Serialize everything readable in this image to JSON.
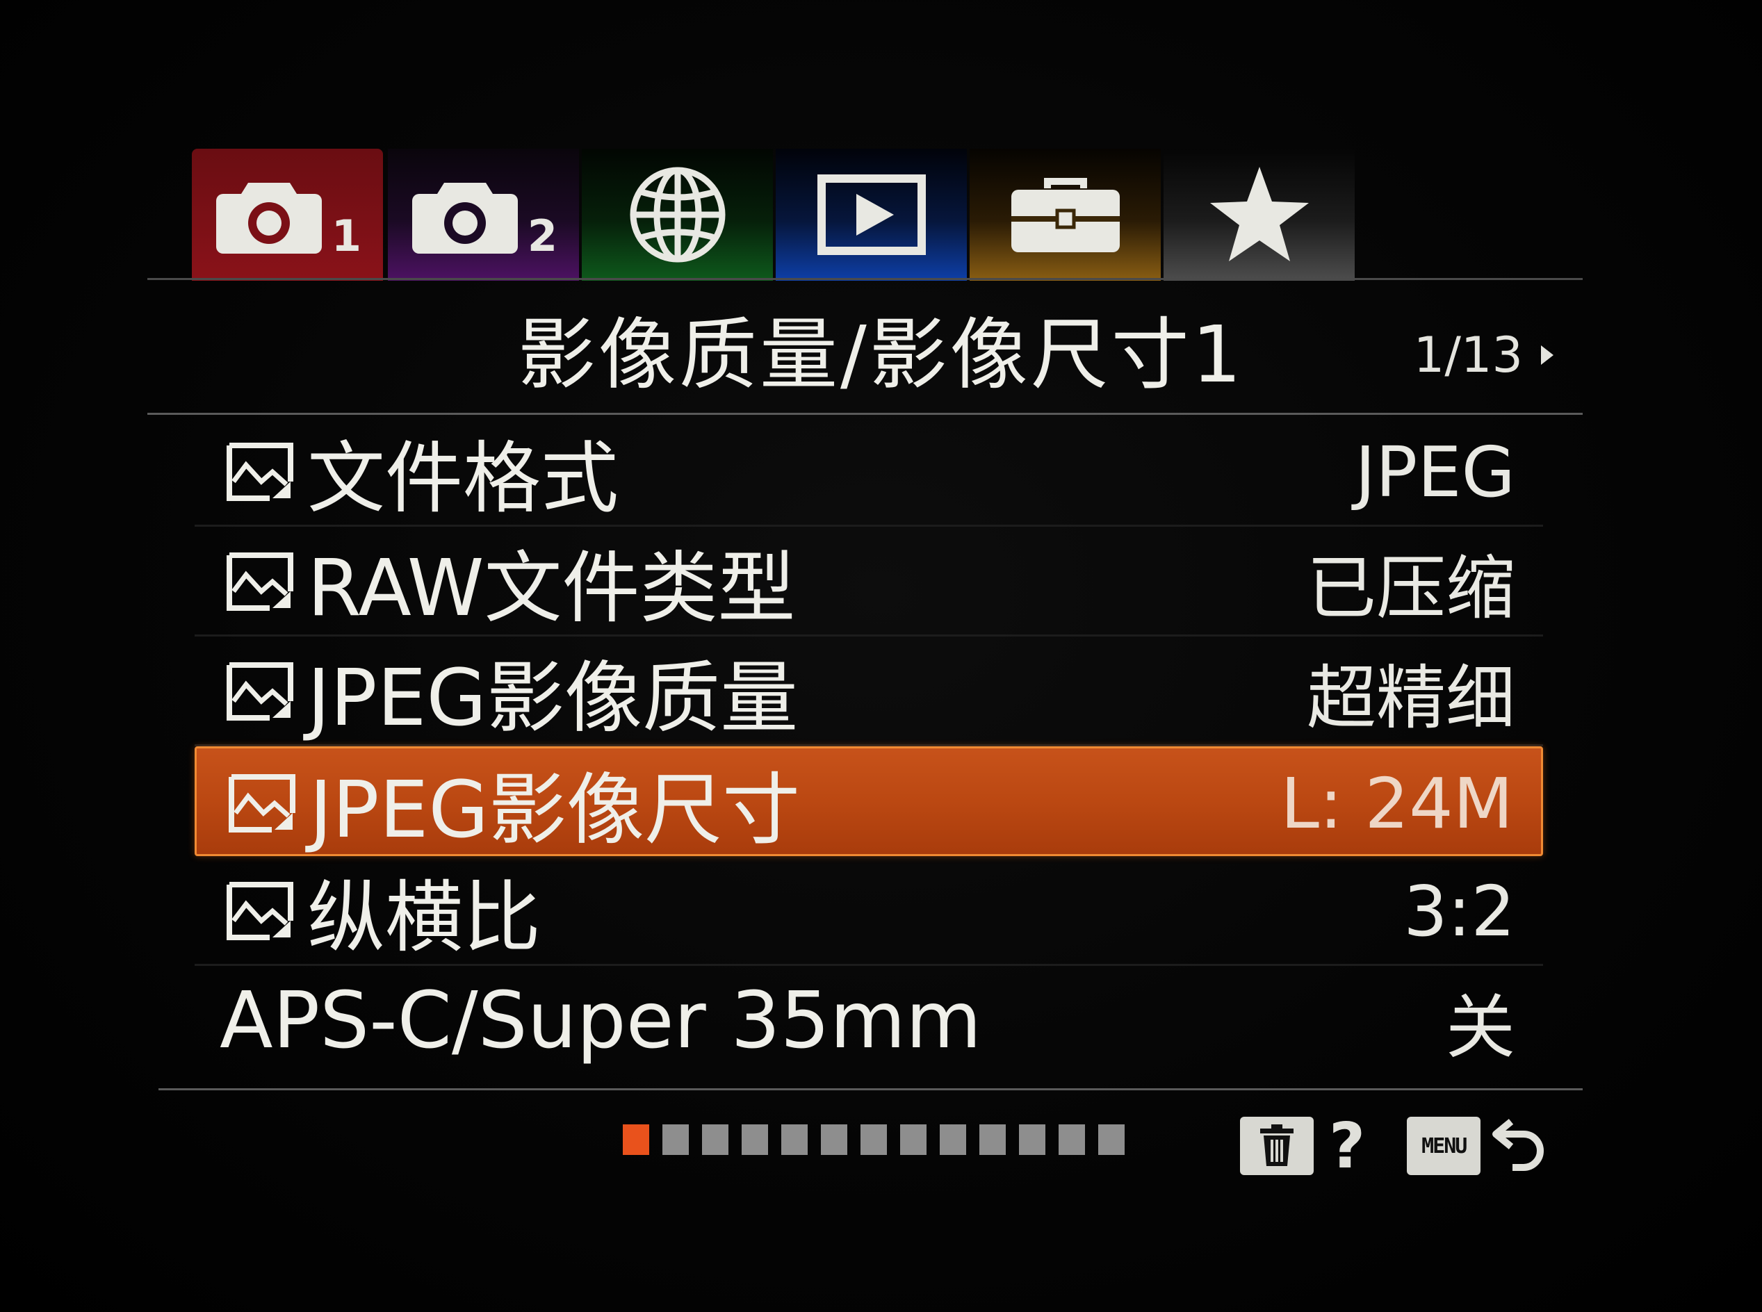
{
  "tabs": [
    {
      "id": "shooting-1",
      "number": "1",
      "color": "#8a1219",
      "active": true
    },
    {
      "id": "shooting-2",
      "number": "2",
      "color": "#4d1263",
      "active": false
    },
    {
      "id": "network",
      "number": "",
      "color": "#0e5a1c",
      "active": false
    },
    {
      "id": "playback",
      "number": "",
      "color": "#0e3fa8",
      "active": false
    },
    {
      "id": "setup",
      "number": "",
      "color": "#8a5e13",
      "active": false
    },
    {
      "id": "my-menu",
      "number": "",
      "color": "#4d4d4d",
      "active": false
    }
  ],
  "header": {
    "title": "影像质量/影像尺寸1",
    "page": "1/13"
  },
  "menu": {
    "items": [
      {
        "label": "文件格式",
        "value": "JPEG",
        "icon": "still-image-icon"
      },
      {
        "label": "RAW文件类型",
        "value": "已压缩",
        "icon": "still-image-icon"
      },
      {
        "label": "JPEG影像质量",
        "value": "超精细",
        "icon": "still-image-icon"
      },
      {
        "label": "JPEG影像尺寸",
        "value": "L: 24M",
        "icon": "still-image-icon",
        "selected": true
      },
      {
        "label": "纵横比",
        "value": "3:2",
        "icon": "still-image-icon"
      },
      {
        "label": "APS-C/Super 35mm",
        "value": "关",
        "icon": ""
      }
    ]
  },
  "pagination": {
    "total": 13,
    "current": 1
  },
  "footer": {
    "help_label": "?",
    "menu_label": "MENU"
  },
  "colors": {
    "highlight": "#bb4812",
    "highlight_border": "#f08a33",
    "active_page": "#e9521c"
  }
}
